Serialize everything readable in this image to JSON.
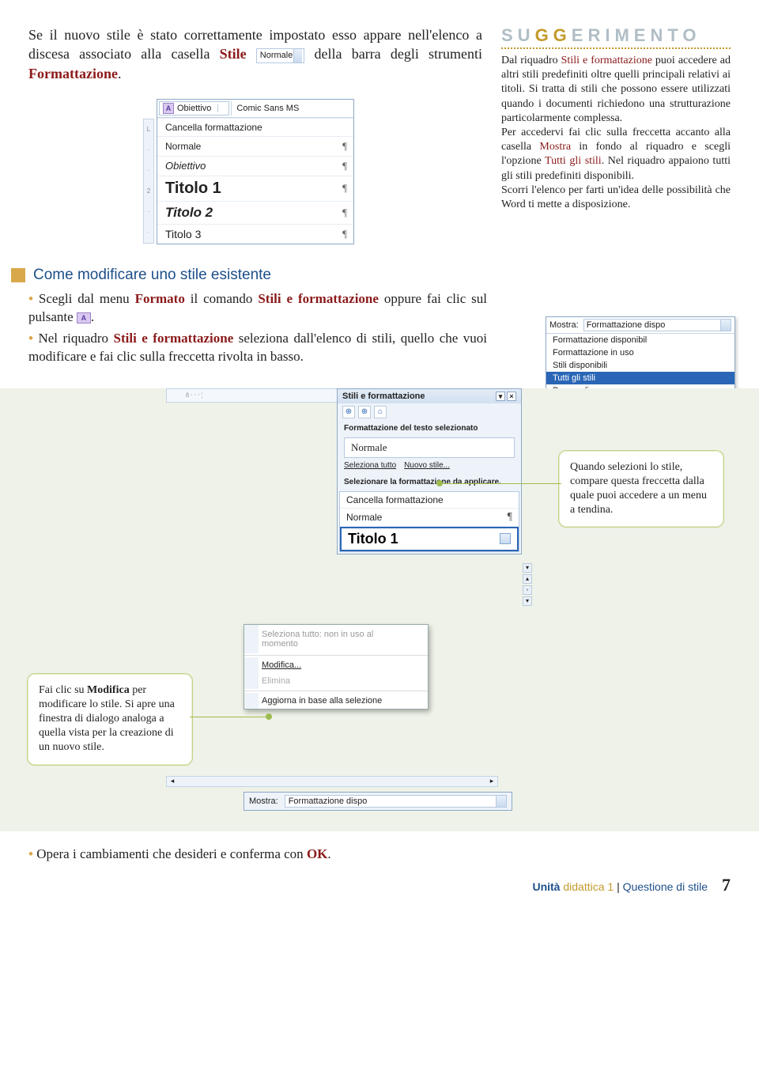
{
  "intro": {
    "pre": "Se il nuovo stile è stato correttamente impostato esso appare nell'elenco a discesa associato alla casella ",
    "stile": "Stile",
    "select_val": "Normale",
    "mid": " della barra degli strumenti ",
    "form": "Formattazione",
    "post": "."
  },
  "styles_dropdown": {
    "header_label": "Obiettivo",
    "font": "Comic Sans MS",
    "ruler_marks": [
      "L",
      "·",
      "·",
      "2",
      "·",
      "·"
    ],
    "rows": [
      {
        "name": "Cancella formattazione",
        "cls": "r-norm",
        "pilc": ""
      },
      {
        "name": "Normale",
        "cls": "r-norm",
        "pilc": "¶"
      },
      {
        "name": "Obiettivo",
        "cls": "r-ob",
        "pilc": "¶"
      },
      {
        "name": "Titolo 1",
        "cls": "r-t1",
        "pilc": "¶"
      },
      {
        "name": "Titolo 2",
        "cls": "r-t2",
        "pilc": "¶"
      },
      {
        "name": "Titolo 3",
        "cls": "r-t3",
        "pilc": "¶"
      }
    ]
  },
  "suggerimento": {
    "title_pre": "SU",
    "title_gg": "GG",
    "title_post": "ERIMENTO",
    "p1a": "Dal riquadro ",
    "p1kw": "Stili e formattazione",
    "p1b": " puoi accedere ad altri stili predefiniti oltre quelli principali relativi ai titoli. Si tratta di stili che possono essere utilizzati quando i documenti richiedono una strutturazione particolarmente complessa.",
    "p2a": "Per accedervi fai clic sulla freccetta accanto alla casella ",
    "p2kw1": "Mostra",
    "p2b": " in fondo al riquadro e scegli l'opzione ",
    "p2kw2": "Tutti gli stili",
    "p2c": ". Nel riquadro appaiono tutti gli stili predefiniti disponibili.",
    "p3": "Scorri l'elenco per farti un'idea delle possibilità che Word ti mette a disposizione."
  },
  "section": {
    "title": "Come modificare uno stile esistente",
    "b1a": "Scegli dal menu ",
    "b1kw1": "Formato",
    "b1b": " il comando ",
    "b1kw2": "Stili e formattazione",
    "b1c": " oppure fai clic sul pulsante ",
    "b2a": "Nel riquadro ",
    "b2kw": "Stili e formattazione",
    "b2b": " seleziona dall'elenco di stili, quello che vuoi modificare e fai clic sulla freccetta rivolta in basso."
  },
  "mostra_dd": {
    "label": "Mostra:",
    "field": "Formattazione dispo",
    "items": [
      "Formattazione disponibil",
      "Formattazione in uso",
      "Stili disponibili",
      "Tutti gli stili",
      "Personalizza..."
    ],
    "selected_index": 3
  },
  "bigpanel": {
    "ruler": "8 · · · ¦",
    "taskpane": {
      "title": "Stili e formattazione",
      "icons": [
        "⊕",
        "⊕",
        "⌂"
      ],
      "sec1": "Formattazione del testo selezionato",
      "cur": "Normale",
      "link_sel": "Seleziona tutto",
      "link_new": "Nuovo stile...",
      "sec2": "Selezionare la formattazione da applicare.",
      "list": [
        {
          "name": "Cancella formattazione",
          "cls": "r-norm",
          "pilc": ""
        },
        {
          "name": "Normale",
          "cls": "r-norm",
          "pilc": "¶"
        },
        {
          "name": "Titolo 1",
          "cls": "",
          "pilc": ""
        }
      ]
    },
    "ctx": {
      "r0": "Seleziona tutto: non in uso al momento",
      "r1": "Modifica...",
      "r2": "Elimina",
      "r3": "Aggiorna in base alla selezione"
    },
    "mostra_bottom": {
      "label": "Mostra:",
      "val": "Formattazione dispo"
    },
    "callout_right": "Quando selezioni lo stile, compare questa freccetta dalla quale puoi accedere a un menu a tendina.",
    "callout_left_a": "Fai clic su ",
    "callout_left_kw": "Modifica",
    "callout_left_b": " per modificare lo stile. Si apre una finestra di dialogo analoga a quella vista per la creazione di un nuovo stile."
  },
  "final_bullet": {
    "a": "Opera i cambiamenti che desideri e conferma con ",
    "kw": "OK",
    "b": "."
  },
  "footer": {
    "u1": "Unità",
    "u2": "didattica 1",
    "sep": "|",
    "q": "Questione di stile",
    "page": "7"
  }
}
